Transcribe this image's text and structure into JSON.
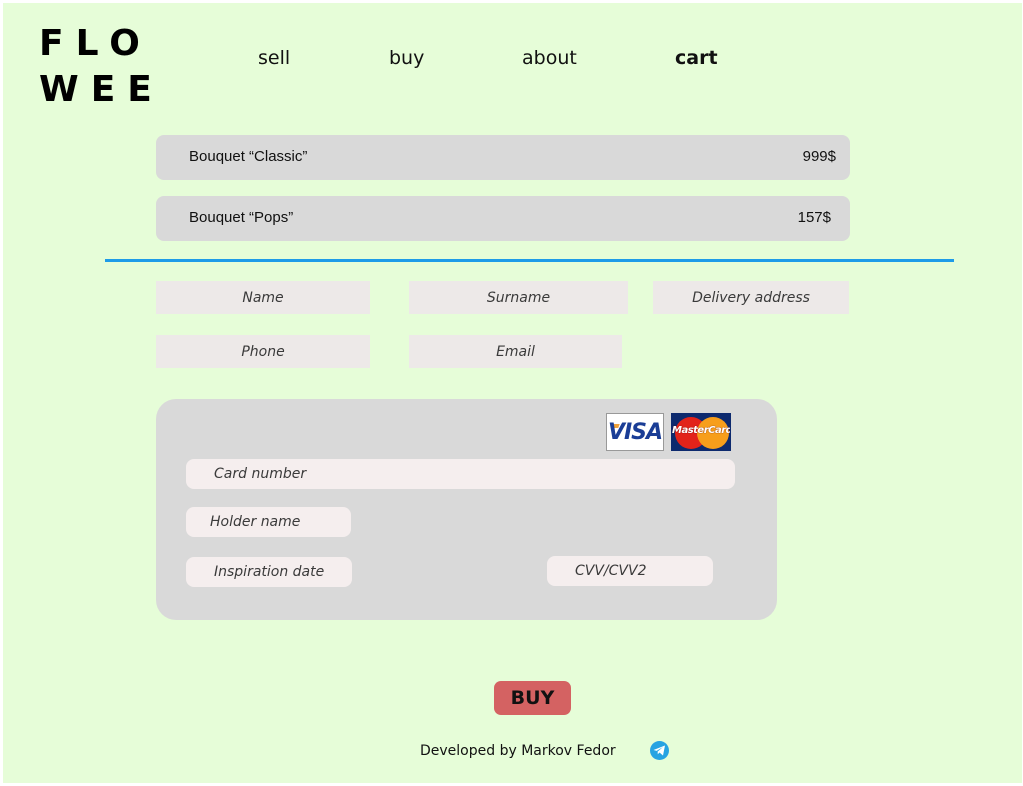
{
  "logo": {
    "line1": "FLO",
    "line2": "WEE"
  },
  "nav": [
    {
      "label": "sell"
    },
    {
      "label": "buy"
    },
    {
      "label": "about"
    },
    {
      "label": "cart"
    }
  ],
  "active_nav": "cart",
  "cart": {
    "items": [
      {
        "name": "Bouquet “Classic”",
        "price": "999$"
      },
      {
        "name": "Bouquet “Pops”",
        "price": "157$"
      }
    ]
  },
  "form": {
    "name_placeholder": "Name",
    "surname_placeholder": "Surname",
    "address_placeholder": "Delivery address",
    "phone_placeholder": "Phone",
    "email_placeholder": "Email"
  },
  "card": {
    "card_number_placeholder": "Card number",
    "holder_placeholder": "Holder name",
    "expiry_placeholder": "Inspiration date",
    "cvv_placeholder": "CVV/CVV2",
    "visa_logo_text": "VISA",
    "mastercard_logo_text": "MasterCard"
  },
  "buy_label": "BUY",
  "footer": {
    "text": "Developed by Markov Fedor",
    "icon": "telegram-icon"
  },
  "colors": {
    "background": "#e6fdd8",
    "panel": "#d9d9d9",
    "divider": "#1e9be8",
    "buy_button": "#d46262",
    "telegram": "#27a3e2"
  }
}
